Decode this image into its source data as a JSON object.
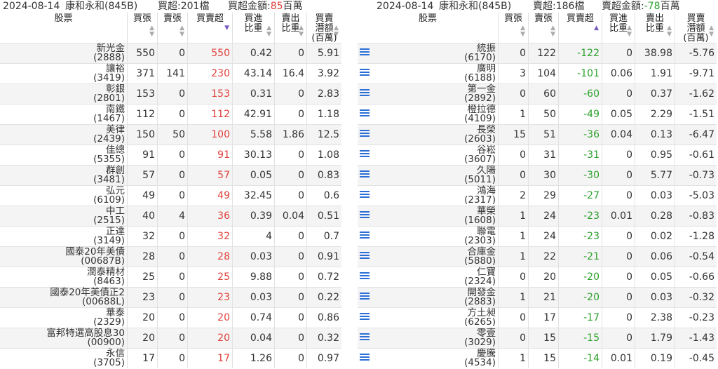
{
  "left": {
    "date": "2024-08-14",
    "broker": "康和永和(845B)",
    "summary_label": "買超:201檔",
    "amount_label": "買超金額:",
    "amount_value": "85",
    "amount_unit": "百萬",
    "headers": {
      "stock": "股票",
      "buy": "買張",
      "sell": "賣張",
      "net": "買賣超",
      "buy_ratio": [
        "買進",
        "比重"
      ],
      "sell_ratio": [
        "賣出",
        "比重"
      ],
      "potential": [
        "買賣",
        "潛額",
        "(百萬)"
      ]
    },
    "rows": [
      {
        "name": "新光金",
        "code": "(2888)",
        "buy": "550",
        "sell": "0",
        "net": "550",
        "buy_ratio": "0.42",
        "sell_ratio": "0",
        "potential": "5.91"
      },
      {
        "name": "讓裕",
        "code": "(3419)",
        "buy": "371",
        "sell": "141",
        "net": "230",
        "buy_ratio": "43.14",
        "sell_ratio": "16.4",
        "potential": "3.92"
      },
      {
        "name": "彰銀",
        "code": "(2801)",
        "buy": "153",
        "sell": "0",
        "net": "153",
        "buy_ratio": "0.31",
        "sell_ratio": "0",
        "potential": "2.83"
      },
      {
        "name": "南鐵",
        "code": "(1467)",
        "buy": "112",
        "sell": "0",
        "net": "112",
        "buy_ratio": "42.91",
        "sell_ratio": "0",
        "potential": "1.18"
      },
      {
        "name": "美律",
        "code": "(2439)",
        "buy": "150",
        "sell": "50",
        "net": "100",
        "buy_ratio": "5.58",
        "sell_ratio": "1.86",
        "potential": "12.5"
      },
      {
        "name": "佳總",
        "code": "(5355)",
        "buy": "91",
        "sell": "0",
        "net": "91",
        "buy_ratio": "30.13",
        "sell_ratio": "0",
        "potential": "1.08"
      },
      {
        "name": "群創",
        "code": "(3481)",
        "buy": "57",
        "sell": "0",
        "net": "57",
        "buy_ratio": "0.05",
        "sell_ratio": "0",
        "potential": "0.83"
      },
      {
        "name": "弘元",
        "code": "(6109)",
        "buy": "49",
        "sell": "0",
        "net": "49",
        "buy_ratio": "32.45",
        "sell_ratio": "0",
        "potential": "0.6"
      },
      {
        "name": "中工",
        "code": "(2515)",
        "buy": "40",
        "sell": "4",
        "net": "36",
        "buy_ratio": "0.39",
        "sell_ratio": "0.04",
        "potential": "0.51"
      },
      {
        "name": "正達",
        "code": "(3149)",
        "buy": "32",
        "sell": "0",
        "net": "32",
        "buy_ratio": "4",
        "sell_ratio": "0",
        "potential": "0.7"
      },
      {
        "name": "國泰20年美債",
        "code": "(00687B)",
        "buy": "28",
        "sell": "0",
        "net": "28",
        "buy_ratio": "0.03",
        "sell_ratio": "0",
        "potential": "0.91"
      },
      {
        "name": "潤泰精材",
        "code": "(8463)",
        "buy": "25",
        "sell": "0",
        "net": "25",
        "buy_ratio": "9.88",
        "sell_ratio": "0",
        "potential": "0.72"
      },
      {
        "name": "國泰20年美債正2",
        "code": "(00688L)",
        "buy": "23",
        "sell": "0",
        "net": "23",
        "buy_ratio": "0.03",
        "sell_ratio": "0",
        "potential": "0.22"
      },
      {
        "name": "華泰",
        "code": "(2329)",
        "buy": "20",
        "sell": "0",
        "net": "20",
        "buy_ratio": "0.74",
        "sell_ratio": "0",
        "potential": "0.86"
      },
      {
        "name": "富邦特選高股息30",
        "code": "(00900)",
        "buy": "20",
        "sell": "0",
        "net": "20",
        "buy_ratio": "0.04",
        "sell_ratio": "0",
        "potential": "0.32"
      },
      {
        "name": "永信",
        "code": "(3705)",
        "buy": "17",
        "sell": "0",
        "net": "17",
        "buy_ratio": "1.26",
        "sell_ratio": "0",
        "potential": "0.97"
      }
    ]
  },
  "right": {
    "date": "2024-08-14",
    "broker": "康和永和(845B)",
    "summary_label": "賣超:186檔",
    "amount_label": "賣超金額:",
    "amount_value": "-78",
    "amount_unit": "百萬",
    "headers": {
      "stock": "股票",
      "buy": "買張",
      "sell": "賣張",
      "net": "買賣超",
      "buy_ratio": [
        "買進",
        "比重"
      ],
      "sell_ratio": [
        "賣出",
        "比重"
      ],
      "potential": [
        "買賣",
        "潛額",
        "(百萬)"
      ]
    },
    "rows": [
      {
        "name": "統振",
        "code": "(6170)",
        "buy": "0",
        "sell": "122",
        "net": "-122",
        "buy_ratio": "0",
        "sell_ratio": "38.98",
        "potential": "-5.76"
      },
      {
        "name": "廣明",
        "code": "(6188)",
        "buy": "3",
        "sell": "104",
        "net": "-101",
        "buy_ratio": "0.06",
        "sell_ratio": "1.91",
        "potential": "-9.71"
      },
      {
        "name": "第一金",
        "code": "(2892)",
        "buy": "0",
        "sell": "60",
        "net": "-60",
        "buy_ratio": "0",
        "sell_ratio": "0.37",
        "potential": "-1.62"
      },
      {
        "name": "橙拉德",
        "code": "(4109)",
        "buy": "1",
        "sell": "50",
        "net": "-49",
        "buy_ratio": "0.05",
        "sell_ratio": "2.29",
        "potential": "-1.51"
      },
      {
        "name": "長榮",
        "code": "(2603)",
        "buy": "15",
        "sell": "51",
        "net": "-36",
        "buy_ratio": "0.04",
        "sell_ratio": "0.13",
        "potential": "-6.47"
      },
      {
        "name": "谷崧",
        "code": "(3607)",
        "buy": "0",
        "sell": "31",
        "net": "-31",
        "buy_ratio": "0",
        "sell_ratio": "0.95",
        "potential": "-0.61"
      },
      {
        "name": "久陽",
        "code": "(5011)",
        "buy": "0",
        "sell": "30",
        "net": "-30",
        "buy_ratio": "0",
        "sell_ratio": "5.77",
        "potential": "-0.73"
      },
      {
        "name": "鴻海",
        "code": "(2317)",
        "buy": "2",
        "sell": "29",
        "net": "-27",
        "buy_ratio": "0",
        "sell_ratio": "0.03",
        "potential": "-5.03"
      },
      {
        "name": "華榮",
        "code": "(1608)",
        "buy": "1",
        "sell": "24",
        "net": "-23",
        "buy_ratio": "0.01",
        "sell_ratio": "0.28",
        "potential": "-0.83"
      },
      {
        "name": "聯電",
        "code": "(2303)",
        "buy": "1",
        "sell": "24",
        "net": "-23",
        "buy_ratio": "0",
        "sell_ratio": "0.02",
        "potential": "-1.28"
      },
      {
        "name": "合庫金",
        "code": "(5880)",
        "buy": "1",
        "sell": "22",
        "net": "-21",
        "buy_ratio": "0",
        "sell_ratio": "0.06",
        "potential": "-0.54"
      },
      {
        "name": "仁寶",
        "code": "(2324)",
        "buy": "0",
        "sell": "20",
        "net": "-20",
        "buy_ratio": "0",
        "sell_ratio": "0.05",
        "potential": "-0.66"
      },
      {
        "name": "開發金",
        "code": "(2883)",
        "buy": "1",
        "sell": "21",
        "net": "-20",
        "buy_ratio": "0",
        "sell_ratio": "0.03",
        "potential": "-0.32"
      },
      {
        "name": "方土昶",
        "code": "(6265)",
        "buy": "0",
        "sell": "17",
        "net": "-17",
        "buy_ratio": "0",
        "sell_ratio": "2.38",
        "potential": "-0.23"
      },
      {
        "name": "零壹",
        "code": "(3029)",
        "buy": "0",
        "sell": "15",
        "net": "-15",
        "buy_ratio": "0",
        "sell_ratio": "1.79",
        "potential": "-1.43"
      },
      {
        "name": "慶騰",
        "code": "(4534)",
        "buy": "1",
        "sell": "15",
        "net": "-14",
        "buy_ratio": "0.01",
        "sell_ratio": "0.19",
        "potential": "-0.45"
      }
    ]
  },
  "colors": {
    "buy_net": "#e0403a",
    "sell_net": "#2ca02c",
    "icon": "#2b6fd6"
  }
}
